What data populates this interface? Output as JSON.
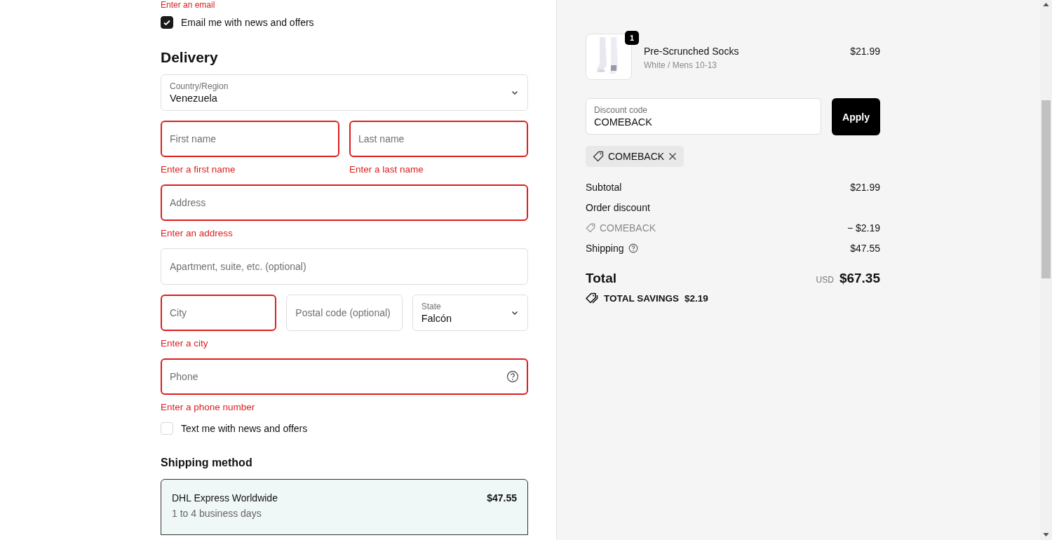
{
  "contact": {
    "error": "Enter an email",
    "email_offers": {
      "label": "Email me with news and offers",
      "checked": true
    }
  },
  "delivery": {
    "heading": "Delivery",
    "rows": [
      [
        {
          "kind": "select",
          "label": "Country/Region",
          "value": "Venezuela",
          "invalid": false
        }
      ],
      [
        {
          "kind": "text",
          "placeholder": "First name",
          "invalid": true,
          "error": "Enter a first name"
        },
        {
          "kind": "text",
          "placeholder": "Last name",
          "invalid": true,
          "error": "Enter a last name"
        }
      ],
      [
        {
          "kind": "text",
          "placeholder": "Address",
          "invalid": true,
          "error": "Enter an address"
        }
      ],
      [
        {
          "kind": "text",
          "placeholder": "Apartment, suite, etc. (optional)",
          "invalid": false
        }
      ],
      [
        {
          "kind": "text",
          "placeholder": "City",
          "invalid": true,
          "error": "Enter a city"
        },
        {
          "kind": "text",
          "placeholder": "Postal code (optional)",
          "invalid": false
        },
        {
          "kind": "select",
          "label": "State",
          "value": "Falcón",
          "invalid": false
        }
      ],
      [
        {
          "kind": "help",
          "placeholder": "Phone",
          "invalid": true,
          "error": "Enter a phone number"
        }
      ]
    ],
    "sms_offers": {
      "label": "Text me with news and offers",
      "checked": false
    }
  },
  "shipping_method": {
    "heading": "Shipping method",
    "options": [
      {
        "name": "DHL Express Worldwide",
        "price": "$47.55",
        "detail": "1 to 4 business days",
        "selected": true
      }
    ]
  },
  "order": {
    "product": {
      "quantity": "1",
      "name": "Pre-Scrunched Socks",
      "variant": "White / Mens 10-13",
      "price": "$21.99"
    },
    "discount": {
      "label": "Discount code",
      "value": "COMEBACK",
      "button": "Apply"
    },
    "applied_code": "COMEBACK",
    "summary": {
      "subtotal_label": "Subtotal",
      "subtotal": "$21.99",
      "discount_label": "Order discount",
      "discount_code": "COMEBACK",
      "discount_amount": "− $2.19",
      "shipping_label": "Shipping",
      "shipping": "$47.55"
    },
    "total": {
      "label": "Total",
      "currency": "USD",
      "amount": "$67.35"
    },
    "savings": {
      "label": "TOTAL SAVINGS",
      "amount": "$2.19"
    }
  }
}
